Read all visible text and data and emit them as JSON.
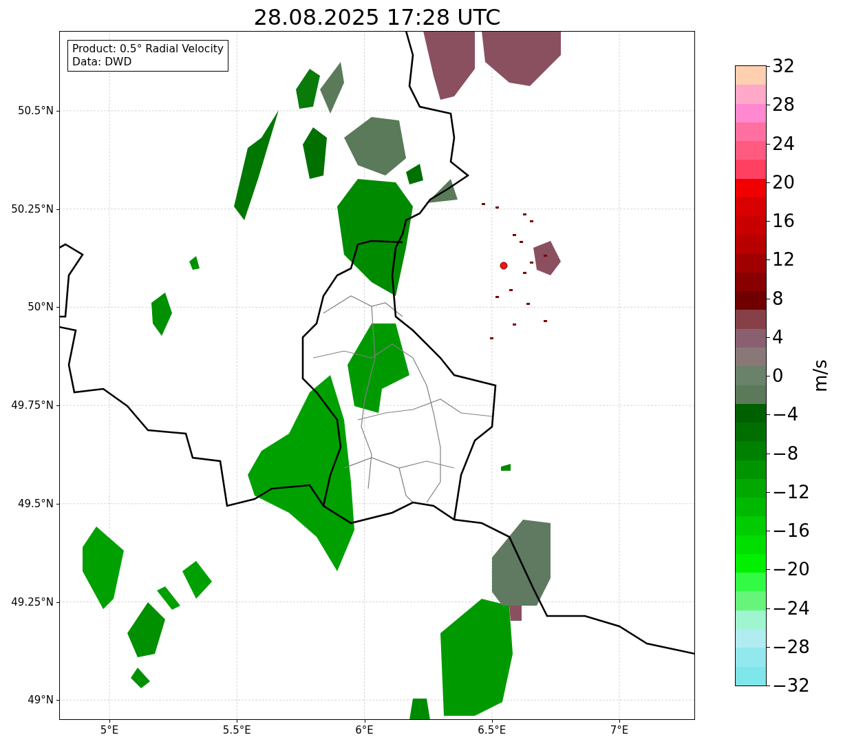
{
  "title": "28.08.2025 17:28 UTC",
  "info_box": {
    "lines": [
      "Product: 0.5° Radial Velocity",
      "Data: DWD"
    ]
  },
  "map": {
    "x_ticks": [
      "5°E",
      "5.5°E",
      "6°E",
      "6.5°E",
      "7°E"
    ],
    "y_ticks": [
      "50.5°N",
      "50.25°N",
      "50°N",
      "49.75°N",
      "49.5°N",
      "49.25°N",
      "49°N"
    ]
  },
  "colorbar": {
    "label": "m/s",
    "ticks": [
      "32",
      "28",
      "24",
      "20",
      "16",
      "12",
      "8",
      "4",
      "0",
      "−4",
      "−8",
      "−12",
      "−16",
      "−20",
      "−24",
      "−28",
      "−32"
    ],
    "bands": [
      {
        "color": "#ffd0b0"
      },
      {
        "color": "#ffa8c8"
      },
      {
        "color": "#ff88d0"
      },
      {
        "color": "#ff70a0"
      },
      {
        "color": "#ff5a80"
      },
      {
        "color": "#ff4060"
      },
      {
        "color": "#f00000"
      },
      {
        "color": "#d80000"
      },
      {
        "color": "#c80000"
      },
      {
        "color": "#b80000"
      },
      {
        "color": "#a00000"
      },
      {
        "color": "#880000"
      },
      {
        "color": "#700000"
      },
      {
        "color": "#884048"
      },
      {
        "color": "#8a6070"
      },
      {
        "color": "#8a7878"
      },
      {
        "color": "#6a826a"
      },
      {
        "color": "#5a7a5a"
      },
      {
        "color": "#006000"
      },
      {
        "color": "#006e00"
      },
      {
        "color": "#008000"
      },
      {
        "color": "#009400"
      },
      {
        "color": "#00a800"
      },
      {
        "color": "#00b800"
      },
      {
        "color": "#00cc00"
      },
      {
        "color": "#00de00"
      },
      {
        "color": "#00f000"
      },
      {
        "color": "#33fa44"
      },
      {
        "color": "#66f57a"
      },
      {
        "color": "#9ff5d0"
      },
      {
        "color": "#b0ecf0"
      },
      {
        "color": "#93e8ee"
      },
      {
        "color": "#7fe6ea"
      }
    ]
  }
}
